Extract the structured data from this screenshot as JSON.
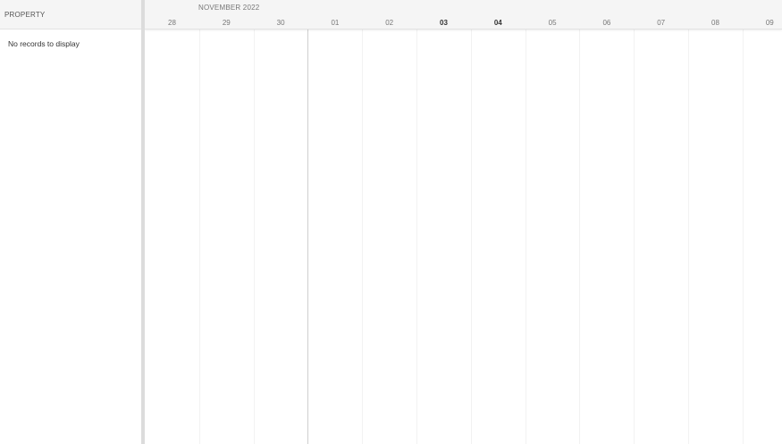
{
  "left_panel": {
    "header_label": "PROPERTY",
    "empty_message": "No records to display"
  },
  "timeline": {
    "month_label": "NOVEMBER 2022",
    "days": [
      {
        "label": "28",
        "bold": false
      },
      {
        "label": "29",
        "bold": false
      },
      {
        "label": "30",
        "bold": false
      },
      {
        "label": "01",
        "bold": false
      },
      {
        "label": "02",
        "bold": false
      },
      {
        "label": "03",
        "bold": true
      },
      {
        "label": "04",
        "bold": true
      },
      {
        "label": "05",
        "bold": false
      },
      {
        "label": "06",
        "bold": false
      },
      {
        "label": "07",
        "bold": false
      },
      {
        "label": "08",
        "bold": false
      },
      {
        "label": "09",
        "bold": false
      }
    ],
    "month_start_index": 3
  },
  "colors": {
    "header_bg": "#f5f5f5",
    "grid_line": "#f2f2f2",
    "divider": "#cfcfcf",
    "splitter": "#dcdcdc"
  }
}
